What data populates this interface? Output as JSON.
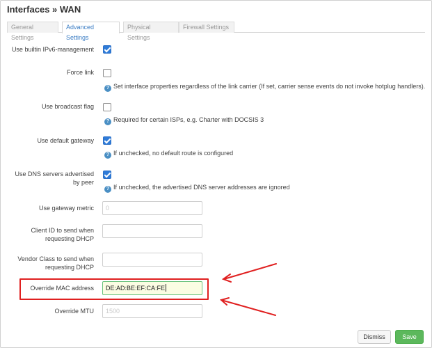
{
  "dialog": {
    "title": "Interfaces » WAN"
  },
  "tabs": [
    {
      "label": "General Settings",
      "active": false
    },
    {
      "label": "Advanced Settings",
      "active": true
    },
    {
      "label": "Physical Settings",
      "active": false
    },
    {
      "label": "Firewall Settings",
      "active": false
    }
  ],
  "fields": {
    "ipv6_mgmt": {
      "label": "Use builtin IPv6-management",
      "checked": true
    },
    "force_link": {
      "label": "Force link",
      "checked": false,
      "help": "Set interface properties regardless of the link carrier (If set, carrier sense events do not invoke hotplug handlers)."
    },
    "broadcast": {
      "label": "Use broadcast flag",
      "checked": false,
      "help": "Required for certain ISPs, e.g. Charter with DOCSIS 3"
    },
    "default_gw": {
      "label": "Use default gateway",
      "checked": true,
      "help": "If unchecked, no default route is configured"
    },
    "peer_dns": {
      "label_line1": "Use DNS servers advertised",
      "label_line2": "by peer",
      "checked": true,
      "help": "If unchecked, the advertised DNS server addresses are ignored"
    },
    "gw_metric": {
      "label": "Use gateway metric",
      "placeholder": "0"
    },
    "client_id": {
      "label_line1": "Client ID to send when",
      "label_line2": "requesting DHCP",
      "value": ""
    },
    "vendor_class": {
      "label_line1": "Vendor Class to send when",
      "label_line2": "requesting DHCP",
      "value": ""
    },
    "mac": {
      "label": "Override MAC address",
      "value": "DE:AD:BE:EF:CA:FE"
    },
    "mtu": {
      "label": "Override MTU",
      "placeholder": "1500"
    }
  },
  "help_icon": "question-circle-icon",
  "annotation_color": "#e02020",
  "buttons": {
    "dismiss": "Dismiss",
    "save": "Save"
  }
}
